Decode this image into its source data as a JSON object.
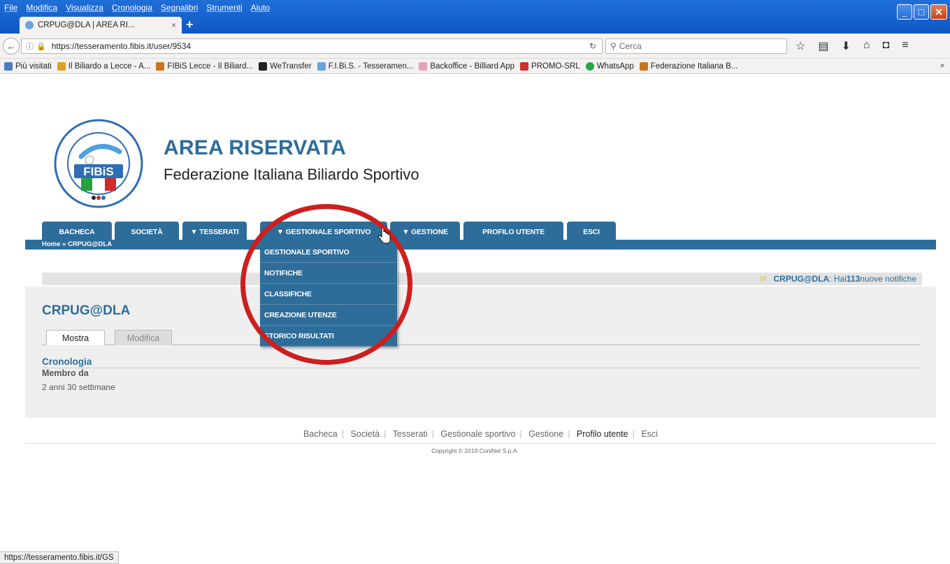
{
  "browser": {
    "menu": [
      "File",
      "Modifica",
      "Visualizza",
      "Cronologia",
      "Segnalibri",
      "Strumenti",
      "Aiuto"
    ],
    "tab_title": "CRPUG@DLA | AREA RI...",
    "tab_close": "×",
    "new_tab": "+",
    "url": "https://tesseramento.fibis.it/user/9534",
    "search_placeholder": "Cerca",
    "bookmarks": [
      {
        "label": "Più visitati",
        "color": "#4a7cc4"
      },
      {
        "label": "Il Biliardo a Lecce - A...",
        "color": "#e0a020"
      },
      {
        "label": "FIBiS Lecce - Il Biliard...",
        "color": "#c9731f"
      },
      {
        "label": "WeTransfer",
        "color": "#222222"
      },
      {
        "label": "F.I.Bi.S. - Tesseramen...",
        "color": "#6aa4df"
      },
      {
        "label": "Backoffice - Billiard App",
        "color": "#e8a0b8"
      },
      {
        "label": "PROMO-SRL",
        "color": "#d22c2c"
      },
      {
        "label": "WhatsApp",
        "color": "#25a844"
      },
      {
        "label": "Federazione Italiana B...",
        "color": "#c9731f"
      }
    ],
    "bookmarks_more": "»",
    "status_url": "https://tesseramento.fibis.it/GS"
  },
  "header": {
    "title": "AREA RISERVATA",
    "subtitle": "Federazione Italiana Biliardo Sportivo",
    "logo_text": "FIBiS"
  },
  "nav": {
    "tabs": [
      "BACHECA",
      "SOCIETÀ",
      "▼ TESSERATI",
      "▼ GESTIONALE SPORTIVO",
      "▼ GESTIONE",
      "PROFILO UTENTE",
      "ESCI"
    ],
    "breadcrumb": "Home » CRPUG@DLA"
  },
  "dropdown": {
    "items": [
      "GESTIONALE SPORTIVO",
      "NOTIFICHE",
      "CLASSIFICHE",
      "CREAZIONE UTENZE",
      "STORICO RISULTATI"
    ]
  },
  "notification": {
    "user": "CRPUG@DLA",
    "prefix": ": Hai ",
    "count": "113",
    "suffix": " nuove notifiche"
  },
  "profile": {
    "title": "CRPUG@DLA",
    "tab_show": "Mostra",
    "tab_edit": "Modifica",
    "history_label": "Cronologia",
    "member_label": "Membro da",
    "member_value": "2 anni 30 settimane"
  },
  "footer": {
    "links": [
      "Bacheca",
      "Società",
      "Tesserati",
      "Gestionale sportivo",
      "Gestione",
      "Profilo utente",
      "Esci"
    ],
    "active": "Profilo utente",
    "copyright": "Copyright © 2019 ConiNet S.p.A."
  },
  "colors": {
    "brand_blue": "#2e6d99",
    "annotation_red": "#cc1f1f"
  }
}
